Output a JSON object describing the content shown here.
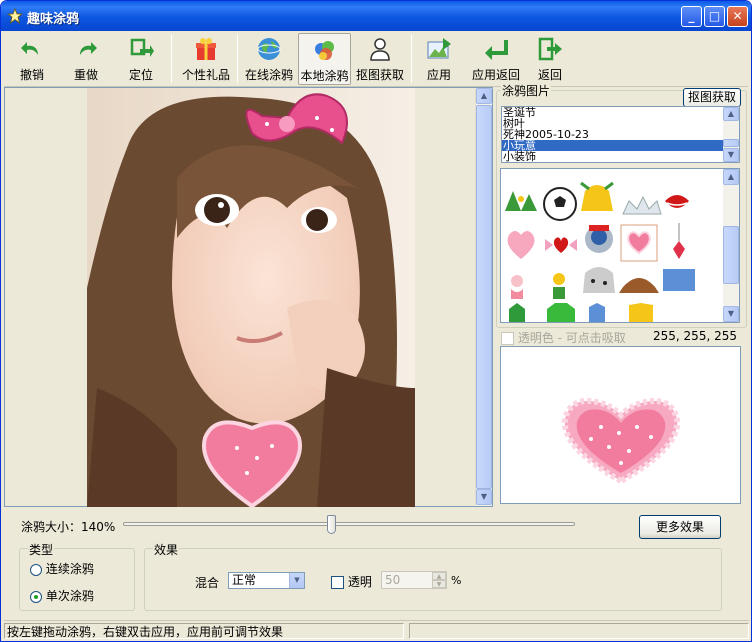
{
  "window": {
    "title": "趣味涂鸦"
  },
  "toolbar": {
    "undo": "撤销",
    "redo": "重做",
    "locate": "定位",
    "gift": "个性礼品",
    "online": "在线涂鸦",
    "local": "本地涂鸦",
    "capture": "抠图获取",
    "apply": "应用",
    "apply_return": "应用返回",
    "return": "返回"
  },
  "graffiti_panel": {
    "group_label": "涂鸦图片",
    "capture_button": "抠图获取",
    "categories": [
      "圣诞节",
      "树叶",
      "死神2005-10-23",
      "小玩意",
      "小装饰"
    ],
    "selected_index": 3
  },
  "transparent": {
    "label": "透明色 - 可点击吸取",
    "rgb": "255, 255, 255"
  },
  "size": {
    "label": "涂鸦大小：",
    "value": "140%",
    "slider_fraction": 0.46
  },
  "more_effects": "更多效果",
  "type_group": {
    "label": "类型",
    "options": [
      "连续涂鸦",
      "单次涂鸦"
    ],
    "selected": 1
  },
  "effect_group": {
    "label": "效果",
    "blend_label": "混合",
    "blend_value": "正常",
    "opacity_label": "透明",
    "opacity_value": "50",
    "percent": "%"
  },
  "status": {
    "text": "按左键拖动涂鸦，右键双击应用，应用前可调节效果"
  },
  "colors": {
    "title_blue": "#0a5ae8",
    "selection": "#316ac5",
    "heart": "#f27c9e"
  }
}
